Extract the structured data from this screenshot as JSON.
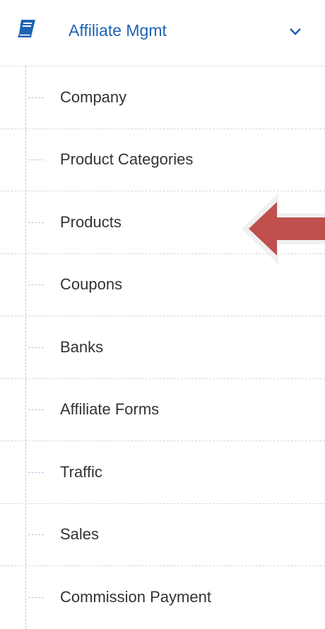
{
  "header": {
    "title": "Affiliate Mgmt",
    "icon": "book-icon",
    "toggle_icon": "chevron-down-icon"
  },
  "menu": {
    "items": [
      {
        "label": "Company"
      },
      {
        "label": "Product Categories"
      },
      {
        "label": "Products"
      },
      {
        "label": "Coupons"
      },
      {
        "label": "Banks"
      },
      {
        "label": "Affiliate Forms"
      },
      {
        "label": "Traffic"
      },
      {
        "label": "Sales"
      },
      {
        "label": "Commission Payment"
      }
    ]
  },
  "annotation": {
    "icon": "arrow-left-icon",
    "color": "#c0504d"
  },
  "colors": {
    "accent": "#1e63b4",
    "text": "#333333",
    "guide": "#b4c8e2"
  }
}
